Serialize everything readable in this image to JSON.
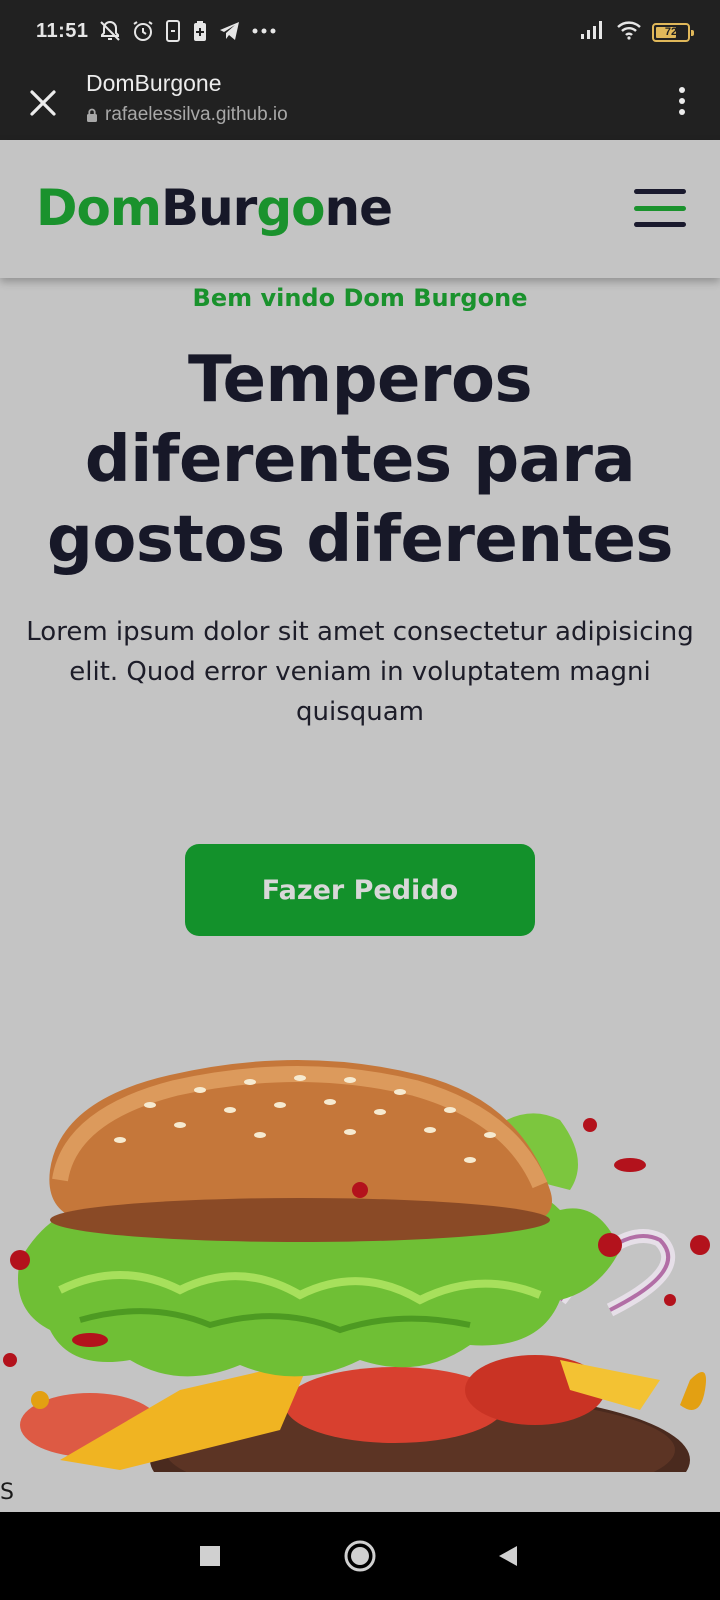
{
  "status_bar": {
    "time": "11:51",
    "battery_level": "72",
    "icons": [
      "notifications-off-icon",
      "alarm-icon",
      "phone-icon",
      "battery-saver-icon",
      "telegram-icon",
      "more-icon",
      "signal-icon",
      "wifi-icon",
      "battery-icon"
    ]
  },
  "browser": {
    "title": "DomBurgone",
    "url": "rafaelessilva.github.io"
  },
  "header": {
    "logo_part1": "Dom",
    "logo_part2": "Bur",
    "logo_part3": "go",
    "logo_part4": "ne"
  },
  "hero": {
    "welcome": "Bem vindo Dom Burgone",
    "headline": "Temperos diferentes para gostos diferentes",
    "description": "Lorem ipsum dolor sit amet consectetur adipisicing elit. Quod error veniam in voluptatem magni quisquam",
    "cta_label": "Fazer Pedido"
  },
  "footer_fragment": "S",
  "colors": {
    "brand_green": "#1a922d",
    "button_green": "#13912b",
    "text_dark": "#171828",
    "page_bg": "#c4c4c4",
    "system_bar": "#212121"
  }
}
